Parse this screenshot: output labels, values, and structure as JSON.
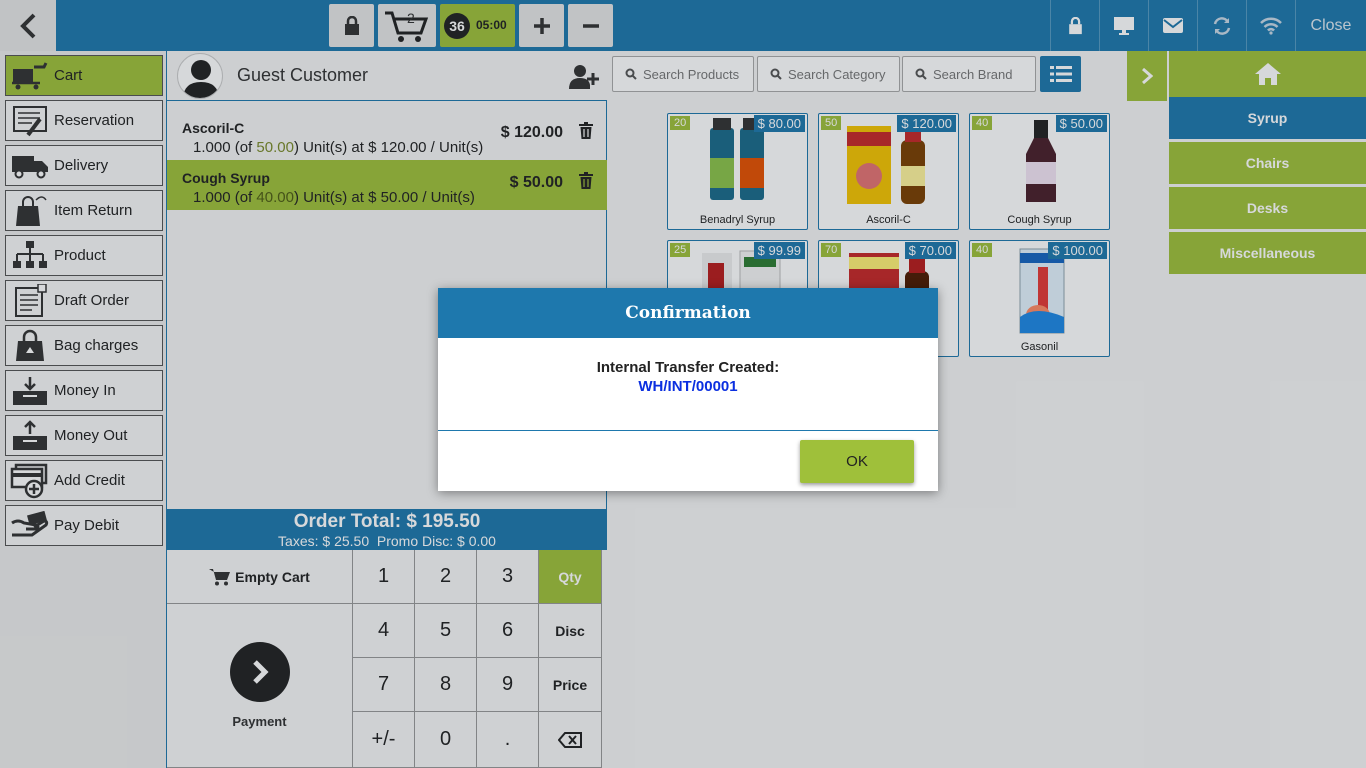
{
  "topbar": {
    "cart_count": "2",
    "session_number": "36",
    "session_time": "05:00",
    "close_label": "Close"
  },
  "sidebar": {
    "items": [
      {
        "label": "Cart",
        "icon": "cart-icon"
      },
      {
        "label": "Reservation",
        "icon": "reservation-icon"
      },
      {
        "label": "Delivery",
        "icon": "delivery-truck-icon"
      },
      {
        "label": "Item Return",
        "icon": "return-bag-icon"
      },
      {
        "label": "Product",
        "icon": "product-tree-icon"
      },
      {
        "label": "Draft Order",
        "icon": "draft-order-icon"
      },
      {
        "label": "Bag charges",
        "icon": "bag-icon"
      },
      {
        "label": "Money In",
        "icon": "money-in-icon"
      },
      {
        "label": "Money Out",
        "icon": "money-out-icon"
      },
      {
        "label": "Add Credit",
        "icon": "add-credit-icon"
      },
      {
        "label": "Pay Debit",
        "icon": "pay-debit-icon"
      }
    ]
  },
  "order": {
    "customer": "Guest Customer",
    "lines": [
      {
        "name": "Ascoril-C",
        "qty": "1.000",
        "stock": "50.00",
        "unit_price": "$ 120.00",
        "price": "$ 120.00"
      },
      {
        "name": "Cough Syrup",
        "qty": "1.000",
        "stock": "40.00",
        "unit_price": "$ 50.00",
        "price": "$ 50.00"
      }
    ],
    "total": "Order Total: $ 195.50",
    "taxes": "Taxes: $ 25.50",
    "promo": "Promo Disc: $ 0.00"
  },
  "keypad": {
    "empty_cart": "Empty Cart",
    "payment": "Payment",
    "keys": [
      "1",
      "2",
      "3",
      "4",
      "5",
      "6",
      "7",
      "8",
      "9",
      "+/-",
      "0",
      "."
    ],
    "modes": [
      "Qty",
      "Disc",
      "Price"
    ]
  },
  "search": {
    "products": "Search Products",
    "category": "Search Category",
    "brand": "Search Brand"
  },
  "products": [
    {
      "name": "Benadryl Syrup",
      "stock": "20",
      "price": "$ 80.00"
    },
    {
      "name": "Ascoril-C",
      "stock": "50",
      "price": "$ 120.00"
    },
    {
      "name": "Cough Syrup",
      "stock": "40",
      "price": "$ 50.00"
    },
    {
      "name": "",
      "stock": "25",
      "price": "$ 99.99"
    },
    {
      "name": "",
      "stock": "70",
      "price": "$ 70.00"
    },
    {
      "name": "Gasonil",
      "stock": "40",
      "price": "$ 100.00"
    }
  ],
  "categories": [
    "Syrup",
    "Chairs",
    "Desks",
    "Miscellaneous"
  ],
  "modal": {
    "title": "Confirmation",
    "message": "Internal Transfer Created:",
    "reference": "WH/INT/00001",
    "ok_label": "OK"
  },
  "colors": {
    "primary": "#1e78ad",
    "accent": "#9fc03a",
    "link": "#0b2fe0"
  }
}
